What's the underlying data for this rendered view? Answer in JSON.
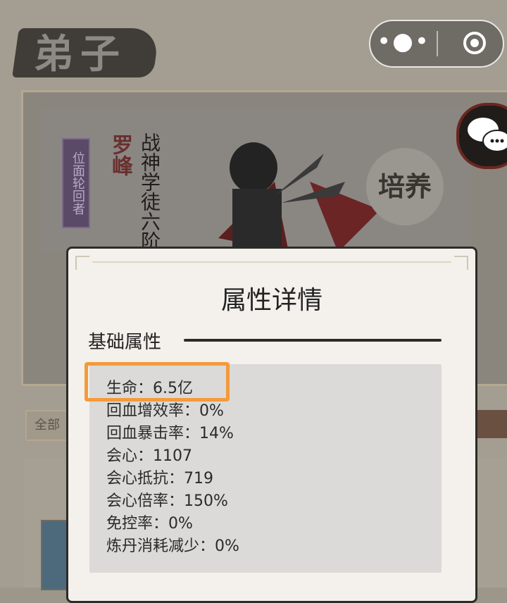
{
  "page": {
    "title": "弟子"
  },
  "character": {
    "badge": "位面轮回者",
    "name": "罗峰",
    "rank": "战神学徒六阶",
    "cultivate_label": "培养"
  },
  "filter": {
    "all_label": "全部"
  },
  "modal": {
    "title": "属性详情",
    "section": "基础属性",
    "stats": [
      "生命：6.5亿",
      "回血增效率：0%",
      "回血暴击率：14%",
      "会心：1107",
      "会心抵抗：719",
      "会心倍率：150%",
      "免控率：0%",
      "炼丹消耗减少：0%"
    ]
  },
  "colors": {
    "highlight": "#f39a3b"
  },
  "icons": {
    "more": "more-dots-icon",
    "close": "target-close-icon",
    "chat": "chat-bubbles-icon"
  }
}
